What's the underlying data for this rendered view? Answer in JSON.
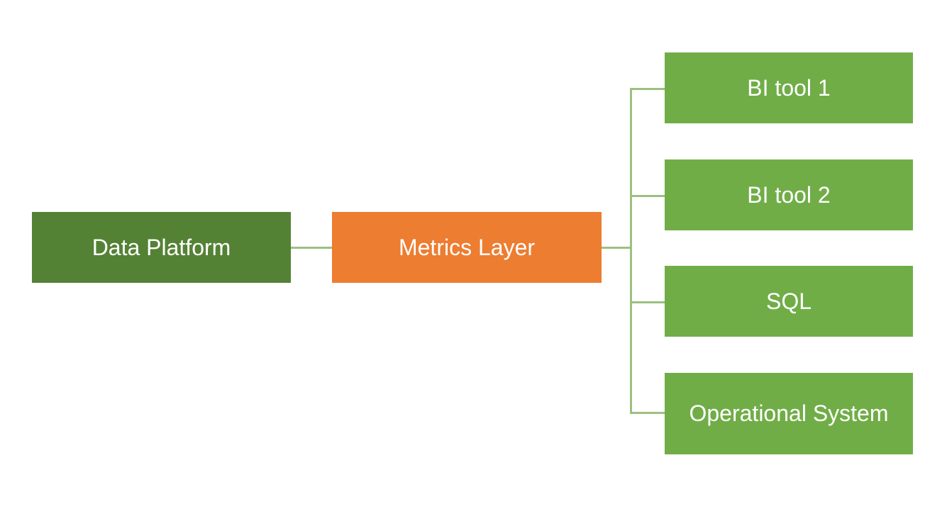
{
  "nodes": {
    "data_platform": "Data Platform",
    "metrics_layer": "Metrics Layer",
    "bi_tool_1": "BI tool 1",
    "bi_tool_2": "BI tool 2",
    "sql": "SQL",
    "operational_system": "Operational System"
  },
  "colors": {
    "dark_green": "#548235",
    "orange": "#ED7D31",
    "light_green": "#70AD47",
    "connector": "#9CC081"
  },
  "edges": [
    [
      "data_platform",
      "metrics_layer"
    ],
    [
      "metrics_layer",
      "bi_tool_1"
    ],
    [
      "metrics_layer",
      "bi_tool_2"
    ],
    [
      "metrics_layer",
      "sql"
    ],
    [
      "metrics_layer",
      "operational_system"
    ]
  ]
}
